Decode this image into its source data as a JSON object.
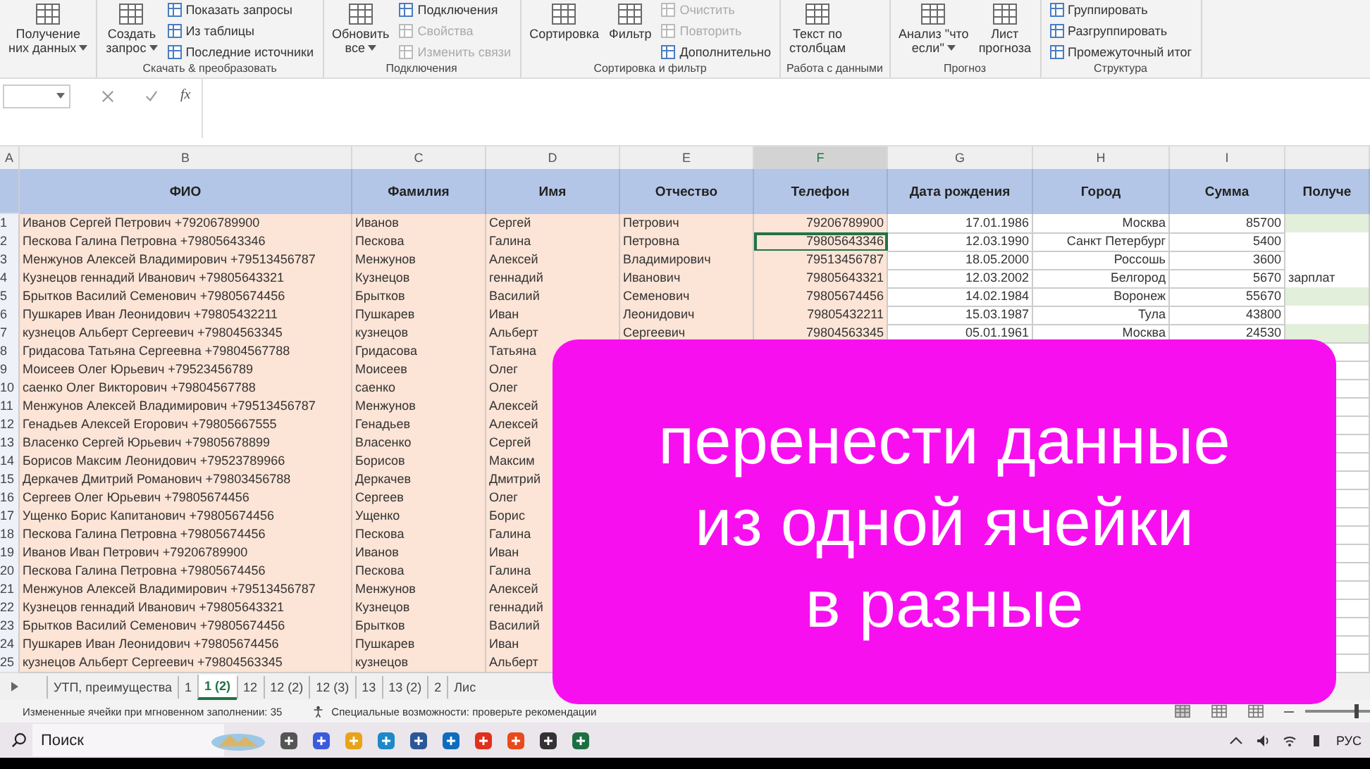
{
  "ribbon": {
    "groups": [
      {
        "large": [
          {
            "lines": [
              "Получение",
              "них данных"
            ],
            "dropdown": true
          }
        ]
      },
      {
        "label": "Скачать & преобразовать",
        "large": [
          {
            "lines": [
              "Создать",
              "запрос"
            ],
            "dropdown": true
          }
        ],
        "small": [
          {
            "text": "Показать запросы",
            "disabled": false
          },
          {
            "text": "Из таблицы",
            "disabled": false
          },
          {
            "text": "Последние источники",
            "disabled": false
          }
        ]
      },
      {
        "label": "Подключения",
        "large": [
          {
            "lines": [
              "Обновить",
              "все"
            ],
            "dropdown": true
          }
        ],
        "small": [
          {
            "text": "Подключения",
            "disabled": false
          },
          {
            "text": "Свойства",
            "disabled": true
          },
          {
            "text": "Изменить связи",
            "disabled": true
          }
        ]
      },
      {
        "label": "Сортировка и фильтр",
        "large": [
          {
            "lines": [
              "Сортировка"
            ],
            "dropdown": false
          },
          {
            "lines": [
              "Фильтр"
            ],
            "dropdown": false
          }
        ],
        "small": [
          {
            "text": "Очистить",
            "disabled": true
          },
          {
            "text": "Повторить",
            "disabled": true
          },
          {
            "text": "Дополнительно",
            "disabled": false
          }
        ]
      },
      {
        "label": "Работа с данными",
        "large": [
          {
            "lines": [
              "Текст по",
              "столбцам"
            ],
            "dropdown": false
          }
        ]
      },
      {
        "label": "Прогноз",
        "large": [
          {
            "lines": [
              "Анализ \"что",
              "если\""
            ],
            "dropdown": true
          },
          {
            "lines": [
              "Лист",
              "прогноза"
            ],
            "dropdown": false
          }
        ]
      },
      {
        "label": "Структура",
        "small": [
          {
            "text": "Группировать",
            "disabled": false
          },
          {
            "text": "Разгруппировать",
            "disabled": false
          },
          {
            "text": "Промежуточный итог",
            "disabled": false
          }
        ]
      }
    ]
  },
  "formula_bar": {
    "function_label": "fx"
  },
  "column_letters": [
    {
      "label": "A",
      "selected": false
    },
    {
      "label": "B",
      "selected": false
    },
    {
      "label": "C",
      "selected": false
    },
    {
      "label": "D",
      "selected": false
    },
    {
      "label": "E",
      "selected": false
    },
    {
      "label": "F",
      "selected": true
    },
    {
      "label": "G",
      "selected": false
    },
    {
      "label": "H",
      "selected": false
    },
    {
      "label": "I",
      "selected": false
    }
  ],
  "table": {
    "columns": [
      "ФИО",
      "Фамилия",
      "Имя",
      "Отчество",
      "Телефон",
      "Дата рождения",
      "Город",
      "Сумма",
      "Получе"
    ],
    "rows": [
      {
        "n": "1",
        "fio": "Иванов Сергей Петрович +79206789900",
        "surname": "Иванов",
        "name": "Сергей",
        "patronymic": "Петрович",
        "phone": "79206789900",
        "birth": "17.01.1986",
        "city": "Москва",
        "sum": "85700",
        "color": "#e2efda",
        "selected": false
      },
      {
        "n": "2",
        "fio": "Пескова Галина Петровна +79805643346",
        "surname": "Пескова",
        "name": "Галина",
        "patronymic": "Петровна",
        "phone": "79805643346",
        "birth": "12.03.1990",
        "city": "Санкт Петербург",
        "sum": "5400",
        "color": "#ffffff",
        "selected": true
      },
      {
        "n": "3",
        "fio": "Менжунов Алексей Владимирович +79513456787",
        "surname": "Менжунов",
        "name": "Алексей",
        "patronymic": "Владимирович",
        "phone": "79513456787",
        "birth": "18.05.2000",
        "city": "Россошь",
        "sum": "3600",
        "color": "#ffffff",
        "selected": false
      },
      {
        "n": "4",
        "fio": "Кузнецов геннадий Иванович +79805643321",
        "surname": "Кузнецов",
        "name": "геннадий",
        "patronymic": "Иванович",
        "phone": "79805643321",
        "birth": "12.03.2002",
        "city": "Белгород",
        "sum": "5670",
        "column_9": "зарплат",
        "color": "#ffffff",
        "selected": false
      },
      {
        "n": "5",
        "fio": "Брытков Василий Семенович +79805674456",
        "surname": "Брытков",
        "name": "Василий",
        "patronymic": "Семенович",
        "phone": "79805674456",
        "birth": "14.02.1984",
        "city": "Воронеж",
        "sum": "55670",
        "color": "#e2efda",
        "selected": false
      },
      {
        "n": "6",
        "fio": "Пушкарев Иван Леонидович +79805432211",
        "surname": "Пушкарев",
        "name": "Иван",
        "patronymic": "Леонидович",
        "phone": "79805432211",
        "birth": "15.03.1987",
        "city": "Тула",
        "sum": "43800",
        "color": "#ffffff",
        "selected": false
      },
      {
        "n": "7",
        "fio": "кузнецов Альберт Сергеевич +79804563345",
        "surname": "кузнецов",
        "name": "Альберт",
        "patronymic": "Сергеевич",
        "phone": "79804563345",
        "birth": "05.01.1961",
        "city": "Москва",
        "sum": "24530",
        "color": "#e2efda",
        "selected": false
      },
      {
        "n": "8",
        "fio": "Гридасова Татьяна Сергеевна +79804567788",
        "surname": "Гридасова",
        "name": "Татьяна"
      },
      {
        "n": "9",
        "fio": "Моисеев Олег Юрьевич +79523456789",
        "surname": "Моисеев",
        "name": "Олег"
      },
      {
        "n": "10",
        "fio": "саенко Олег Викторович +79804567788",
        "surname": "саенко",
        "name": "Олег"
      },
      {
        "n": "11",
        "fio": "Менжунов Алексей Владимирович +79513456787",
        "surname": "Менжунов",
        "name": "Алексей"
      },
      {
        "n": "12",
        "fio": "Генадьев Алексей Егорович +79805667555",
        "surname": "Генадьев",
        "name": "Алексей"
      },
      {
        "n": "13",
        "fio": "Власенко Сергей Юрьевич +79805678899",
        "surname": "Власенко",
        "name": "Сергей"
      },
      {
        "n": "14",
        "fio": "Борисов Максим Леонидович +79523789966",
        "surname": "Борисов",
        "name": "Максим"
      },
      {
        "n": "15",
        "fio": "Деркачев Дмитрий Романович +79803456788",
        "surname": "Деркачев",
        "name": "Дмитрий"
      },
      {
        "n": "16",
        "fio": "Сергеев Олег Юрьевич +79805674456",
        "surname": "Сергеев",
        "name": "Олег"
      },
      {
        "n": "17",
        "fio": "Ущенко Борис Капитанович +79805674456",
        "surname": "Ущенко",
        "name": "Борис"
      },
      {
        "n": "18",
        "fio": "Пескова Галина Петровна +79805674456",
        "surname": "Пескова",
        "name": "Галина"
      },
      {
        "n": "19",
        "fio": "Иванов Иван Петрович +79206789900",
        "surname": "Иванов",
        "name": "Иван"
      },
      {
        "n": "20",
        "fio": "Пескова Галина Петровна +79805674456",
        "surname": "Пескова",
        "name": "Галина"
      },
      {
        "n": "21",
        "fio": "Менжунов Алексей Владимирович +79513456787",
        "surname": "Менжунов",
        "name": "Алексей"
      },
      {
        "n": "22",
        "fio": "Кузнецов геннадий Иванович +79805643321",
        "surname": "Кузнецов",
        "name": "геннадий"
      },
      {
        "n": "23",
        "fio": "Брытков Василий Семенович +79805674456",
        "surname": "Брытков",
        "name": "Василий"
      },
      {
        "n": "24",
        "fio": "Пушкарев Иван Леонидович +79805674456",
        "surname": "Пушкарев",
        "name": "Иван"
      },
      {
        "n": "25",
        "fio": "кузнецов Альберт Сергеевич +79804563345",
        "surname": "кузнецов",
        "name": "Альберт"
      }
    ]
  },
  "sheet_tabs": [
    {
      "label": "УТП, преимущества",
      "selected": false
    },
    {
      "label": "1",
      "selected": false
    },
    {
      "label": "1 (2)",
      "selected": true
    },
    {
      "label": "12",
      "selected": false
    },
    {
      "label": "12 (2)",
      "selected": false
    },
    {
      "label": "12 (3)",
      "selected": false
    },
    {
      "label": "13",
      "selected": false
    },
    {
      "label": "13 (2)",
      "selected": false
    },
    {
      "label": "2",
      "selected": false
    },
    {
      "label": "Лис",
      "selected": false
    }
  ],
  "status_bar": {
    "flash_fill": "Измененные ячейки при мгновенном заполнении: 35",
    "accessibility": "Специальные возможности: проверьте рекомендации",
    "views": [
      {
        "selected": true
      },
      {
        "selected": false
      },
      {
        "selected": false
      }
    ],
    "zoom": {
      "level": 0.75
    }
  },
  "taskbar": {
    "search": {
      "placeholder": "Поиск"
    },
    "language": "РУС"
  },
  "banner": {
    "lines": [
      "перенести данные",
      "из одной ячейки",
      "в разные"
    ]
  }
}
